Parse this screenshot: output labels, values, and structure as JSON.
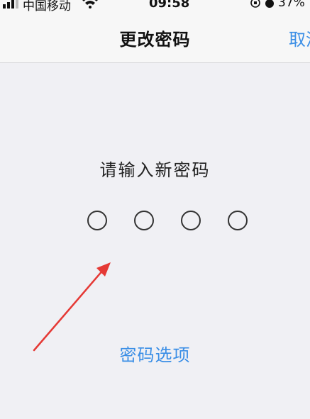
{
  "status_bar": {
    "carrier": "中国移动",
    "time": "09:58",
    "battery": "37%"
  },
  "nav": {
    "title": "更改密码",
    "right_button": "取消"
  },
  "prompt": "请输入新密码",
  "passcode": {
    "length": 4,
    "entered": 0
  },
  "options_link": "密码选项",
  "colors": {
    "accent": "#3a8ee6",
    "background": "#f0f0f4",
    "annotation_arrow": "#e53935"
  }
}
